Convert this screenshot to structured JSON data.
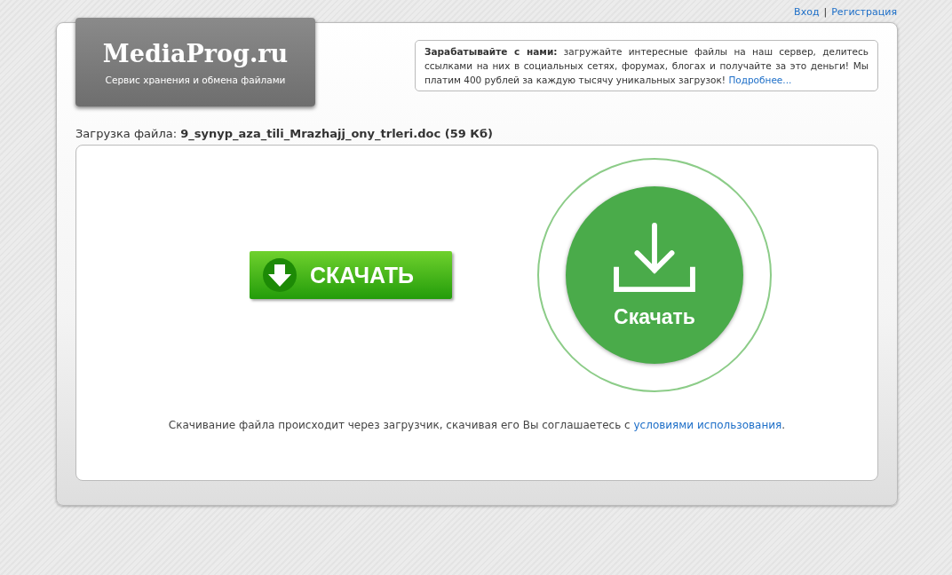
{
  "auth_links": [
    {
      "label": "Вход"
    },
    {
      "label": "Регистрация"
    }
  ],
  "auth_separator": "|",
  "logo": {
    "title": "MediaProg.ru",
    "tagline": "Сервис хранения и обмена файлами"
  },
  "promo": {
    "text": "**Зарабатывайте с нами:** загружайте интересные файлы на наш сервер, делитесь ссылками на них в социальных сетях, форумах, блогах и получайте за это деньги! Мы платим 400 рублей за каждую тысячу уникальных загрузок!",
    "link": "Подробнее..."
  },
  "file_heading": "Загрузка файла: **9_synyp_aza_tili_Mrazhajj_ony_trleri.doc (59 Кб)**",
  "download_buttons": [
    {
      "kind": "banner",
      "label": "СКАЧАТЬ"
    },
    {
      "kind": "circle",
      "label": "Скачать"
    }
  ],
  "notice": {
    "text": "Скачивание файла происходит через загрузчик, скачивая его Вы соглашаетесь с",
    "link": "условиями использования",
    "end": "."
  }
}
